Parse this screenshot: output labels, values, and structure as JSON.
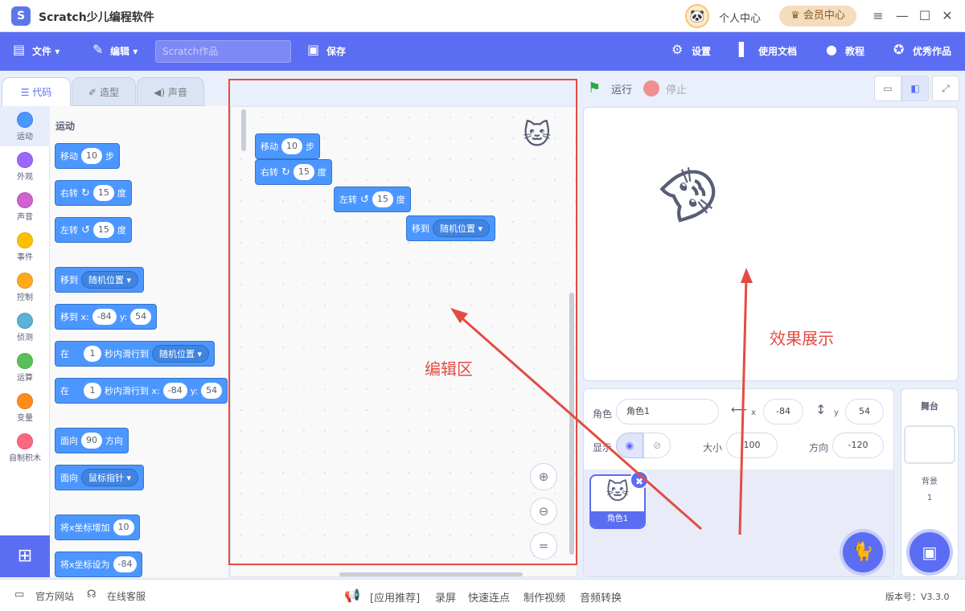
{
  "app": {
    "title": "Scratch少儿编程软件",
    "user_center": "个人中心",
    "vip": "会员中心"
  },
  "menu": {
    "file": "文件",
    "edit": "编辑",
    "project_placeholder": "Scratch作品",
    "save": "保存",
    "settings": "设置",
    "docs": "使用文档",
    "tutorial": "教程",
    "showcase": "优秀作品"
  },
  "tabs": {
    "code": "代码",
    "costume": "造型",
    "sound": "声音"
  },
  "categories": [
    {
      "label": "运动",
      "color": "#4c97ff"
    },
    {
      "label": "外观",
      "color": "#9966ff"
    },
    {
      "label": "声音",
      "color": "#cf63cf"
    },
    {
      "label": "事件",
      "color": "#ffbf00"
    },
    {
      "label": "控制",
      "color": "#ffab19"
    },
    {
      "label": "侦测",
      "color": "#5cb1d6"
    },
    {
      "label": "运算",
      "color": "#59c059"
    },
    {
      "label": "变量",
      "color": "#ff8c1a"
    },
    {
      "label": "自制积木",
      "color": "#ff6680"
    }
  ],
  "palette": {
    "category_title": "运动",
    "move": {
      "pre": "移动",
      "val": "10",
      "post": "步"
    },
    "turn_right": {
      "pre": "右转",
      "val": "15",
      "post": "度"
    },
    "turn_left": {
      "pre": "左转",
      "val": "15",
      "post": "度"
    },
    "goto": {
      "pre": "移到",
      "dd": "随机位置"
    },
    "goto_xy": {
      "pre": "移到 x:",
      "x": "-84",
      "ylabel": "y:",
      "y": "54"
    },
    "glide": {
      "pre": "在",
      "val": "1",
      "mid": "秒内滑行到",
      "dd": "随机位置"
    },
    "glide_xy": {
      "pre": "在",
      "val": "1",
      "mid": "秒内滑行到 x:",
      "x": "-84",
      "ylabel": "y:",
      "y": "54"
    },
    "point": {
      "pre": "面向",
      "val": "90",
      "post": "方向"
    },
    "point_towards": {
      "pre": "面向",
      "dd": "鼠标指针"
    },
    "change_x": {
      "pre": "将x坐标增加",
      "val": "10"
    },
    "set_x": {
      "pre": "将x坐标设为",
      "val": "-84"
    }
  },
  "workspace": {
    "move": {
      "pre": "移动",
      "val": "10",
      "post": "步"
    },
    "turn_right": {
      "pre": "右转",
      "val": "15",
      "post": "度"
    },
    "turn_left": {
      "pre": "左转",
      "val": "15",
      "post": "度"
    },
    "goto": {
      "pre": "移到",
      "dd": "随机位置"
    },
    "annotation": "编辑区"
  },
  "runbar": {
    "run": "运行",
    "stop": "停止"
  },
  "stage": {
    "annotation": "效果展示"
  },
  "sprite": {
    "sprite_label": "角色",
    "sprite_name": "角色1",
    "x_label": "x",
    "x": "-84",
    "y_label": "y",
    "y": "54",
    "show_label": "显示",
    "size_label": "大小",
    "size": "100",
    "direction_label": "方向",
    "direction": "-120",
    "thumb_name": "角色1"
  },
  "stage_panel": {
    "title": "舞台",
    "backdrops_label": "背景",
    "backdrops_count": "1"
  },
  "status": {
    "website": "官方网站",
    "support": "在线客服",
    "recommend": "[应用推荐]",
    "apps": [
      "录屏",
      "快速连点",
      "制作视频",
      "音频转换"
    ],
    "version": "版本号：V3.3.0"
  },
  "colors": {
    "accent": "#5b6df2",
    "motion": "#4c97ff",
    "annotation": "#e34c43"
  }
}
